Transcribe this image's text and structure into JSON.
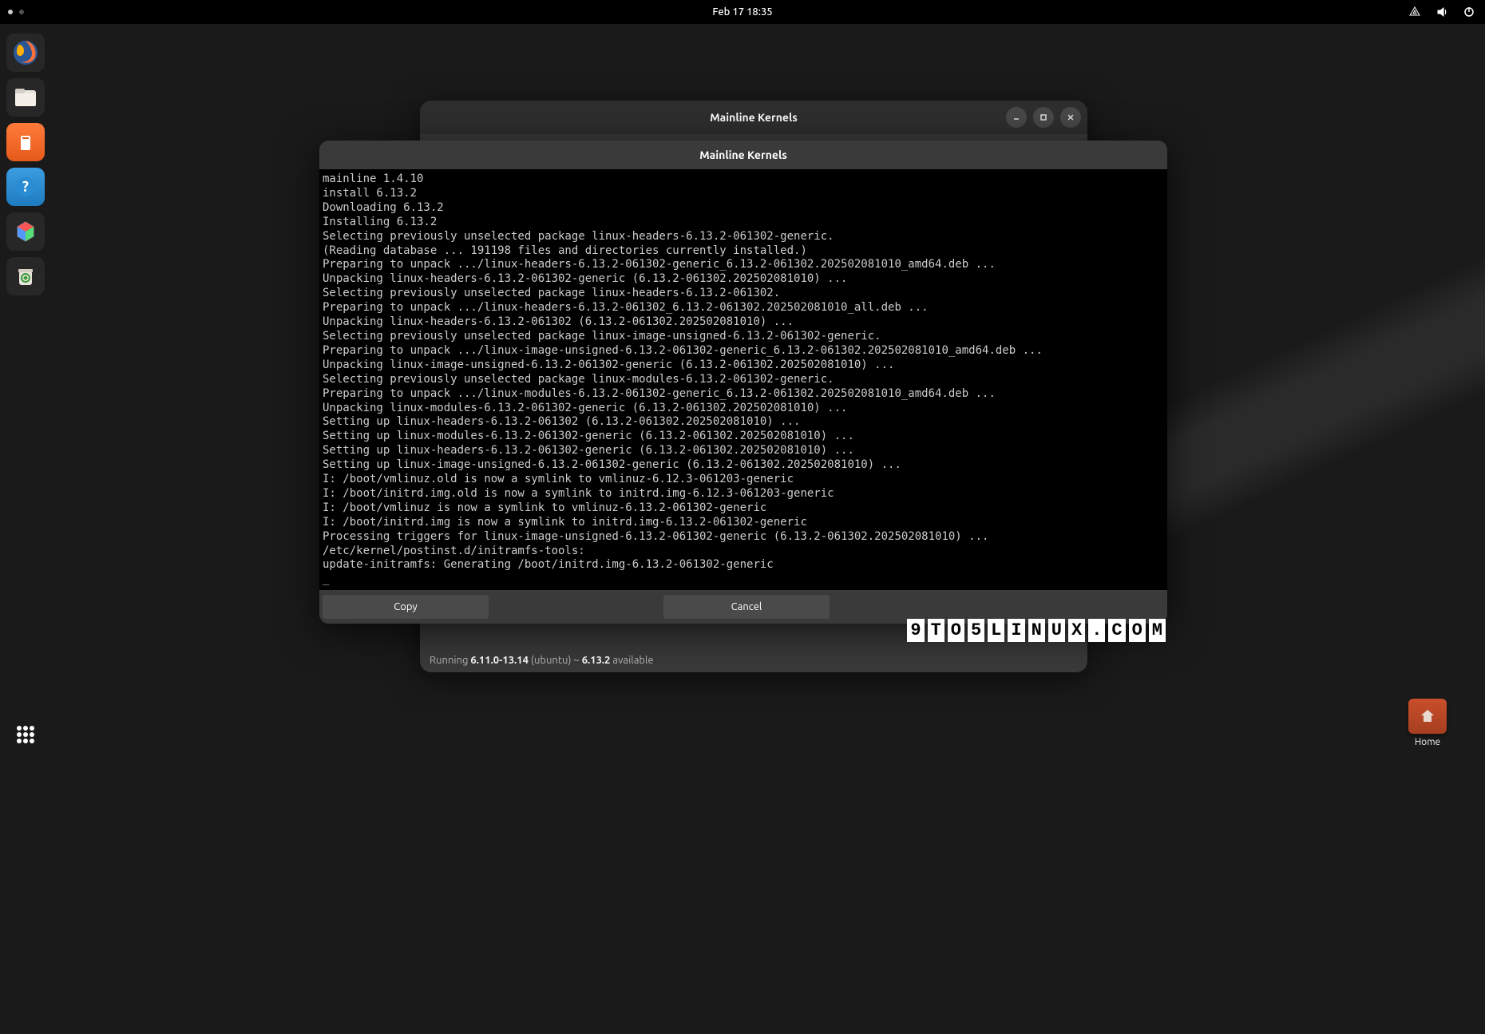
{
  "topbar": {
    "datetime": "Feb 17  18:35"
  },
  "dock": {
    "activities_label": "Show Applications"
  },
  "parent_window": {
    "title": "Mainline Kernels",
    "status_prefix": "Running ",
    "status_running": "6.11.0-13.14",
    "status_flavor": " (ubuntu) ~ ",
    "status_available_ver": "6.13.2",
    "status_available_suffix": " available"
  },
  "dialog": {
    "title": "Mainline Kernels",
    "terminal_lines": [
      "mainline 1.4.10",
      "install 6.13.2",
      "Downloading 6.13.2",
      "Installing 6.13.2",
      "Selecting previously unselected package linux-headers-6.13.2-061302-generic.",
      "(Reading database ... 191198 files and directories currently installed.)",
      "Preparing to unpack .../linux-headers-6.13.2-061302-generic_6.13.2-061302.202502081010_amd64.deb ...",
      "Unpacking linux-headers-6.13.2-061302-generic (6.13.2-061302.202502081010) ...",
      "Selecting previously unselected package linux-headers-6.13.2-061302.",
      "Preparing to unpack .../linux-headers-6.13.2-061302_6.13.2-061302.202502081010_all.deb ...",
      "Unpacking linux-headers-6.13.2-061302 (6.13.2-061302.202502081010) ...",
      "Selecting previously unselected package linux-image-unsigned-6.13.2-061302-generic.",
      "Preparing to unpack .../linux-image-unsigned-6.13.2-061302-generic_6.13.2-061302.202502081010_amd64.deb ...",
      "Unpacking linux-image-unsigned-6.13.2-061302-generic (6.13.2-061302.202502081010) ...",
      "Selecting previously unselected package linux-modules-6.13.2-061302-generic.",
      "Preparing to unpack .../linux-modules-6.13.2-061302-generic_6.13.2-061302.202502081010_amd64.deb ...",
      "Unpacking linux-modules-6.13.2-061302-generic (6.13.2-061302.202502081010) ...",
      "Setting up linux-headers-6.13.2-061302 (6.13.2-061302.202502081010) ...",
      "Setting up linux-modules-6.13.2-061302-generic (6.13.2-061302.202502081010) ...",
      "Setting up linux-headers-6.13.2-061302-generic (6.13.2-061302.202502081010) ...",
      "Setting up linux-image-unsigned-6.13.2-061302-generic (6.13.2-061302.202502081010) ...",
      "I: /boot/vmlinuz.old is now a symlink to vmlinuz-6.12.3-061203-generic",
      "I: /boot/initrd.img.old is now a symlink to initrd.img-6.12.3-061203-generic",
      "I: /boot/vmlinuz is now a symlink to vmlinuz-6.13.2-061302-generic",
      "I: /boot/initrd.img is now a symlink to initrd.img-6.13.2-061302-generic",
      "Processing triggers for linux-image-unsigned-6.13.2-061302-generic (6.13.2-061302.202502081010) ...",
      "/etc/kernel/postinst.d/initramfs-tools:",
      "update-initramfs: Generating /boot/initrd.img-6.13.2-061302-generic"
    ],
    "cursor": "_",
    "copy_label": "Copy",
    "cancel_label": "Cancel"
  },
  "desktop": {
    "home_label": "Home"
  },
  "watermark": {
    "text": "9TO5LINUX.COM"
  }
}
